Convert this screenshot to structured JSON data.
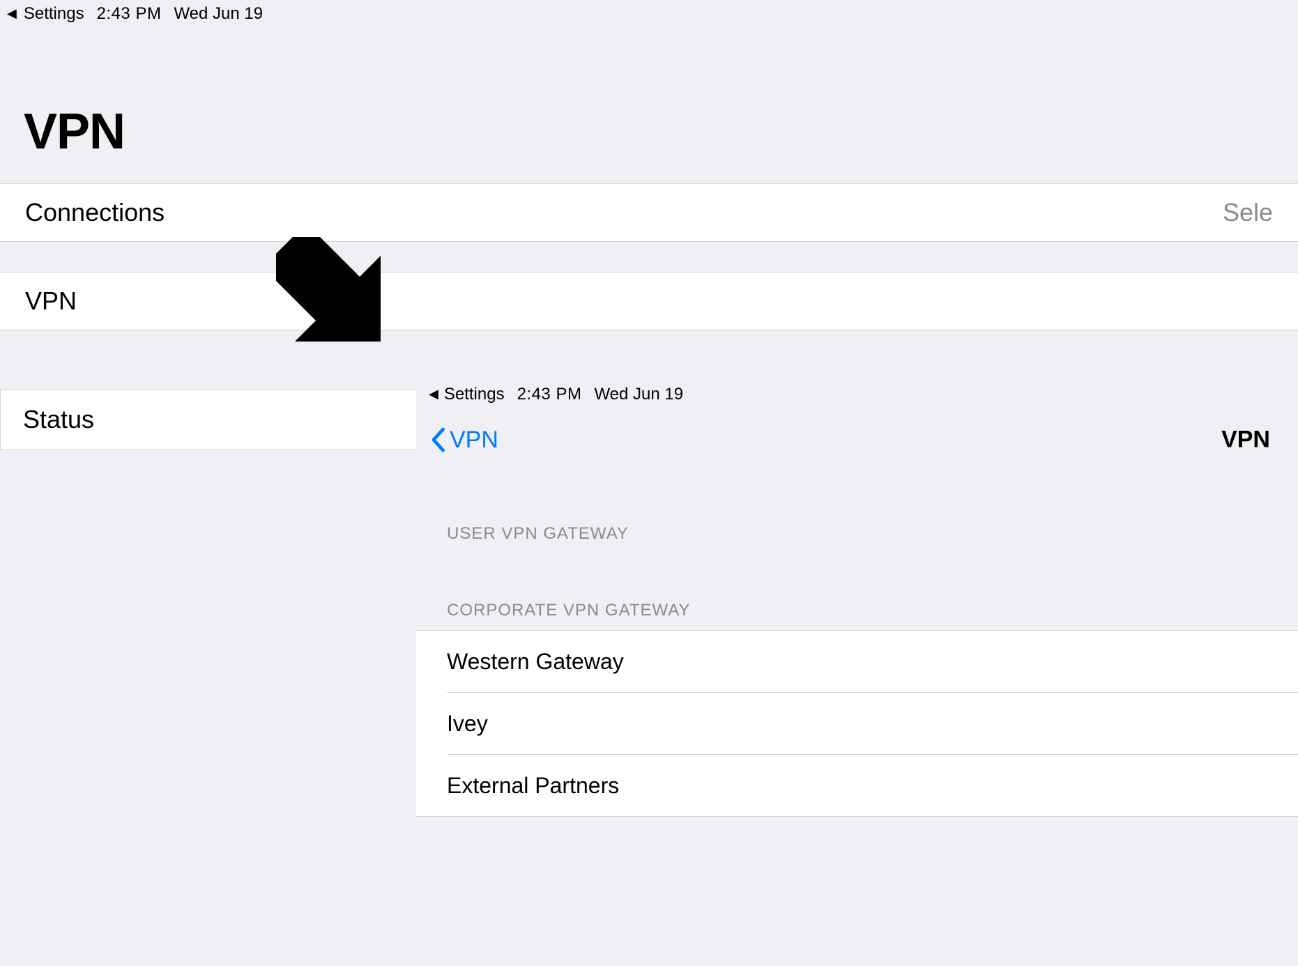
{
  "bg": {
    "statusbar": {
      "back_label": "Settings",
      "time": "2:43 PM",
      "date": "Wed Jun 19"
    },
    "title": "VPN",
    "rows": {
      "connections": {
        "label": "Connections",
        "action": "Sele"
      },
      "vpn": {
        "label": "VPN"
      }
    },
    "status": {
      "label": "Status"
    }
  },
  "fg": {
    "statusbar": {
      "back_label": "Settings",
      "time": "2:43 PM",
      "date": "Wed Jun 19"
    },
    "nav": {
      "back_label": "VPN",
      "title": "VPN"
    },
    "sections": {
      "user_header": "USER VPN GATEWAY",
      "corp_header": "CORPORATE VPN GATEWAY",
      "corp_items": [
        "Western Gateway",
        "Ivey",
        "External Partners"
      ]
    }
  }
}
